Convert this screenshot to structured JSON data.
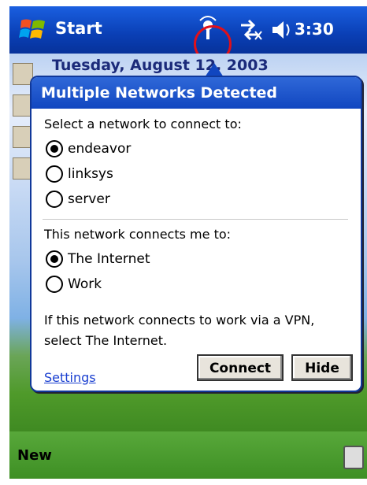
{
  "taskbar": {
    "start_label": "Start",
    "clock": "3:30",
    "icons": [
      "windows-flag-icon",
      "wireless-network-icon",
      "connectivity-icon",
      "volume-icon"
    ]
  },
  "today": {
    "date": "Tuesday, August 12, 2003"
  },
  "dialog": {
    "title": "Multiple Networks Detected",
    "select_prompt": "Select a network to connect to:",
    "networks": [
      {
        "label": "endeavor",
        "selected": true
      },
      {
        "label": "linksys",
        "selected": false
      },
      {
        "label": "server",
        "selected": false
      }
    ],
    "connects_prompt": "This network connects me to:",
    "destinations": [
      {
        "label": "The Internet",
        "selected": true
      },
      {
        "label": "Work",
        "selected": false
      }
    ],
    "note": "If this network connects to work via a VPN, select The Internet.",
    "settings_link": "Settings",
    "connect_button": "Connect",
    "hide_button": "Hide"
  },
  "bottombar": {
    "new_label": "New",
    "icons": [
      "keyboard-icon"
    ]
  },
  "colors": {
    "titlebar": "#0a3fb5",
    "highlight_ring": "#e0101a",
    "bottombar": "#3e8f24"
  }
}
